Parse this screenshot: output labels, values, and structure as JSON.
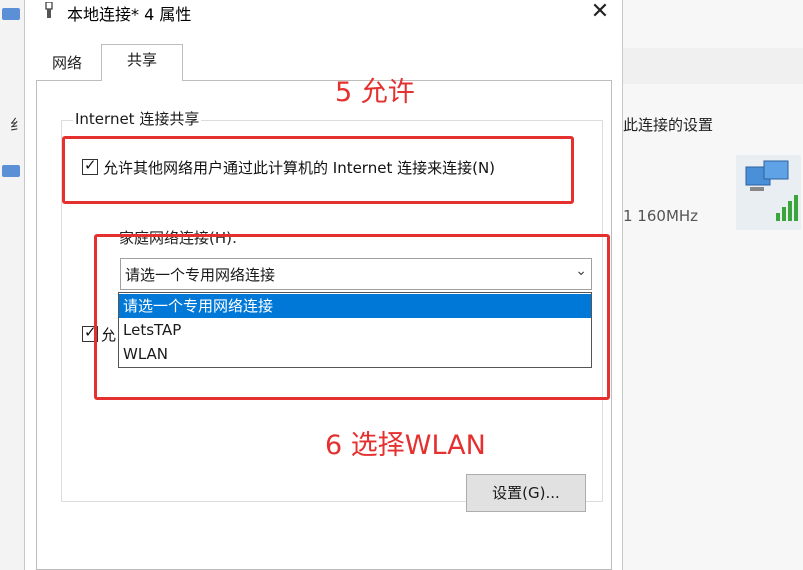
{
  "background": {
    "left_letter": "纟",
    "right_texts": [
      "此连接的设置",
      "1 160MHz"
    ]
  },
  "dialog": {
    "title": "本地连接* 4 属性",
    "close_glyph": "✕",
    "tabs": [
      {
        "label": "网络",
        "active": false
      },
      {
        "label": "共享",
        "active": true
      }
    ],
    "sharing": {
      "group_title": "Internet 连接共享",
      "allow_checkbox": {
        "label": "允许其他网络用户通过此计算机的 Internet 连接来连接(N)",
        "checked": true,
        "glyph": "✓"
      },
      "second_checkbox": {
        "label": "允",
        "checked": true,
        "glyph": "✓"
      },
      "home_network_label": "家庭网络连接(H):",
      "select": {
        "value": "请选一个专用网络连接",
        "options": [
          "请选一个专用网络连接",
          "LetsTAP",
          "WLAN"
        ],
        "chevron": "⌄"
      },
      "settings_button": "设置(G)..."
    }
  },
  "annotations": {
    "step5": "5 允许",
    "step6": "6 选择WLAN"
  },
  "colors": {
    "accent": "#e53030",
    "selection": "#0078d7"
  },
  "icons": {
    "title": "network-adapter-icon",
    "close": "close-icon",
    "background_network": "network-status-icon"
  }
}
